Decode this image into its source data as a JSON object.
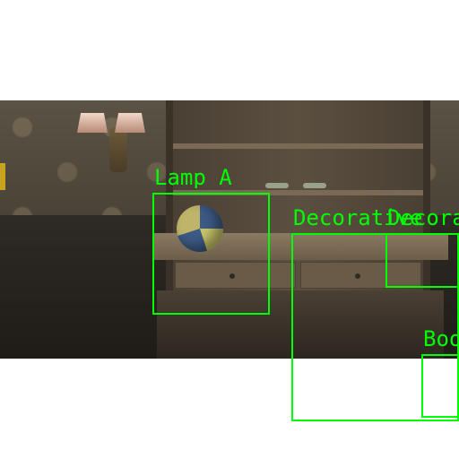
{
  "scene": {
    "description_icon": "dim-room-with-shelving-unit-icon"
  },
  "detections": [
    {
      "id": "lamp_a",
      "label": "Lamp A"
    },
    {
      "id": "decorative_1",
      "label": "Decorative"
    },
    {
      "id": "decorative_2",
      "label": "Decorative"
    },
    {
      "id": "book",
      "label": "Boo"
    }
  ],
  "colors": {
    "bbox": "#00ff00",
    "background": "#ffffff"
  }
}
